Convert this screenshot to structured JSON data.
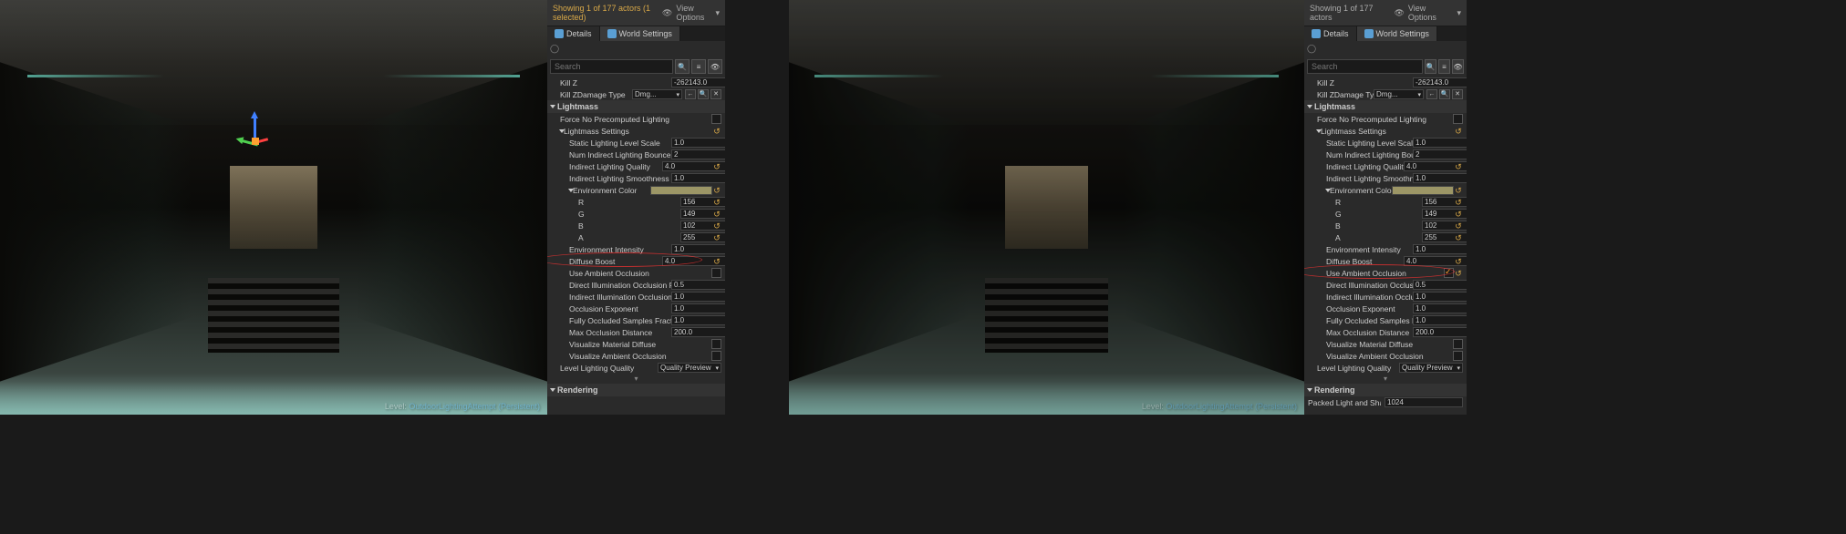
{
  "left": {
    "status": {
      "text": "Showing 1 of 177 actors (1 selected)",
      "view_options": "View Options"
    },
    "tabs": {
      "details": "Details",
      "world": "World Settings"
    },
    "search": {
      "placeholder": "Search"
    },
    "props": {
      "kill_z": {
        "label": "Kill Z",
        "value": "-262143.0"
      },
      "kill_zdamage": {
        "label": "Kill ZDamage Type",
        "value": "Dmg..."
      },
      "lightmass_hdr": "Lightmass",
      "force_no_precomp": {
        "label": "Force No Precomputed Lighting"
      },
      "lightmass_settings": "Lightmass Settings",
      "static_scale": {
        "label": "Static Lighting Level Scale",
        "value": "1.0"
      },
      "num_bounces": {
        "label": "Num Indirect Lighting Bounces",
        "value": "2"
      },
      "indirect_quality": {
        "label": "Indirect Lighting Quality",
        "value": "4.0"
      },
      "indirect_smooth": {
        "label": "Indirect Lighting Smoothness",
        "value": "1.0"
      },
      "env_color": "Environment Color",
      "r": {
        "label": "R",
        "value": "156"
      },
      "g": {
        "label": "G",
        "value": "149"
      },
      "b": {
        "label": "B",
        "value": "102"
      },
      "a": {
        "label": "A",
        "value": "255"
      },
      "env_intensity": {
        "label": "Environment Intensity",
        "value": "1.0"
      },
      "diffuse_boost": {
        "label": "Diffuse Boost",
        "value": "4.0"
      },
      "use_ao": {
        "label": "Use Ambient Occlusion",
        "checked": false
      },
      "direct_ao": {
        "label": "Direct Illumination Occlusion Frac",
        "value": "0.5"
      },
      "indirect_ao": {
        "label": "Indirect Illumination Occlusion Fr",
        "value": "1.0"
      },
      "occ_exp": {
        "label": "Occlusion Exponent",
        "value": "1.0"
      },
      "fully_occ": {
        "label": "Fully Occluded Samples Fraction",
        "value": "1.0"
      },
      "max_occ": {
        "label": "Max Occlusion Distance",
        "value": "200.0"
      },
      "vis_mat_diff": {
        "label": "Visualize Material Diffuse"
      },
      "vis_ao": {
        "label": "Visualize Ambient Occlusion"
      },
      "level_quality": {
        "label": "Level Lighting Quality",
        "value": "Quality Preview"
      },
      "rendering_hdr": "Rendering"
    },
    "level": {
      "prefix": "Level:",
      "name": "OutdoorLightingAttempt (Persistent)"
    }
  },
  "right": {
    "status": {
      "text": "Showing 1 of 177 actors",
      "view_options": "View Options"
    },
    "tabs": {
      "details": "Details",
      "world": "World Settings"
    },
    "search": {
      "placeholder": "Search"
    },
    "props": {
      "kill_z": {
        "label": "Kill Z",
        "value": "-262143.0"
      },
      "kill_zdamage": {
        "label": "Kill ZDamage Type",
        "value": "Dmg..."
      },
      "lightmass_hdr": "Lightmass",
      "force_no_precomp": {
        "label": "Force No Precomputed Lighting"
      },
      "lightmass_settings": "Lightmass Settings",
      "static_scale": {
        "label": "Static Lighting Level Scale",
        "value": "1.0"
      },
      "num_bounces": {
        "label": "Num Indirect Lighting Bounces",
        "value": "2"
      },
      "indirect_quality": {
        "label": "Indirect Lighting Quality",
        "value": "4.0"
      },
      "indirect_smooth": {
        "label": "Indirect Lighting Smoothness",
        "value": "1.0"
      },
      "env_color": "Environment Color",
      "r": {
        "label": "R",
        "value": "156"
      },
      "g": {
        "label": "G",
        "value": "149"
      },
      "b": {
        "label": "B",
        "value": "102"
      },
      "a": {
        "label": "A",
        "value": "255"
      },
      "env_intensity": {
        "label": "Environment Intensity",
        "value": "1.0"
      },
      "diffuse_boost": {
        "label": "Diffuse Boost",
        "value": "4.0"
      },
      "use_ao": {
        "label": "Use Ambient Occlusion",
        "checked": true
      },
      "direct_ao": {
        "label": "Direct Illumination Occlusion Frac",
        "value": "0.5"
      },
      "indirect_ao": {
        "label": "Indirect Illumination Occlusion Fr",
        "value": "1.0"
      },
      "occ_exp": {
        "label": "Occlusion Exponent",
        "value": "1.0"
      },
      "fully_occ": {
        "label": "Fully Occluded Samples Fraction",
        "value": "1.0"
      },
      "max_occ": {
        "label": "Max Occlusion Distance",
        "value": "200.0"
      },
      "vis_mat_diff": {
        "label": "Visualize Material Diffuse"
      },
      "vis_ao": {
        "label": "Visualize Ambient Occlusion"
      },
      "level_quality": {
        "label": "Level Lighting Quality",
        "value": "Quality Preview"
      },
      "rendering_hdr": "Rendering",
      "packed_light": {
        "label": "Packed Light and Shadow Map Text",
        "value": "1024"
      }
    },
    "level": {
      "prefix": "Level:",
      "name": "OutdoorLightingAttempt (Persistent)"
    }
  }
}
